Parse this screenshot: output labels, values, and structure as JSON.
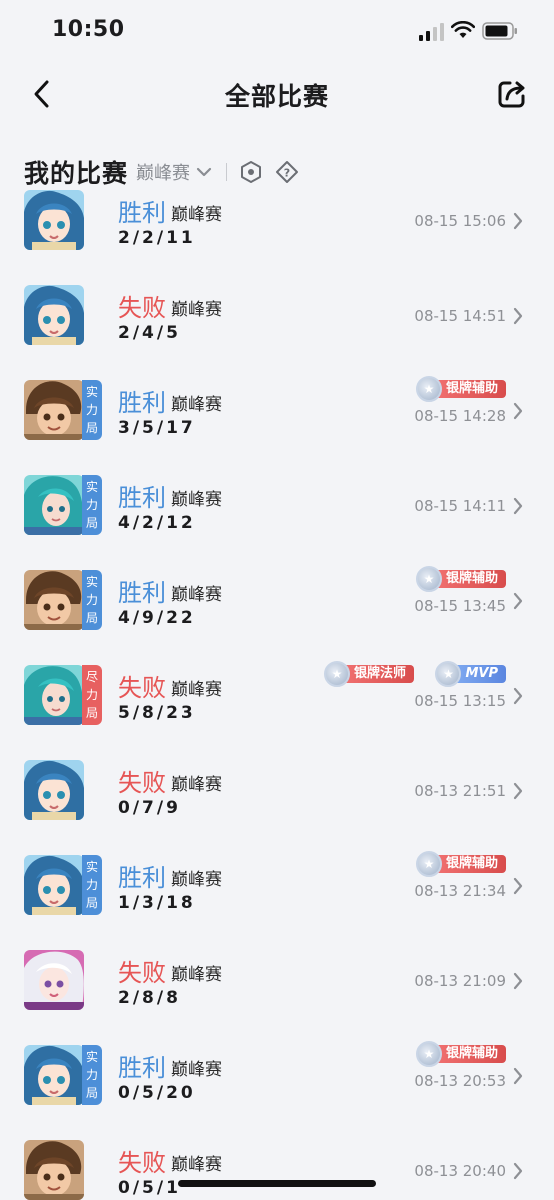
{
  "status_bar": {
    "time": "10:50"
  },
  "nav": {
    "title": "全部比赛"
  },
  "section": {
    "title": "我的比赛",
    "mode_filter": "巅峰赛"
  },
  "matches": [
    {
      "result": "胜利",
      "outcome": "win",
      "mode": "巅峰赛",
      "kda": "2/2/11",
      "time": "08-15 15:06",
      "hero": "blue-hair-girl",
      "tag": null,
      "badges": []
    },
    {
      "result": "失败",
      "outcome": "lose",
      "mode": "巅峰赛",
      "kda": "2/4/5",
      "time": "08-15 14:51",
      "hero": "blue-hair-girl",
      "tag": null,
      "badges": []
    },
    {
      "result": "胜利",
      "outcome": "win",
      "mode": "巅峰赛",
      "kda": "3/5/17",
      "time": "08-15 14:28",
      "hero": "brown-hair-boy",
      "tag": "实力局",
      "tag_color": "blue",
      "badges": [
        "银牌辅助"
      ]
    },
    {
      "result": "胜利",
      "outcome": "win",
      "mode": "巅峰赛",
      "kda": "4/2/12",
      "time": "08-15 14:11",
      "hero": "teal-hair-woman",
      "tag": "实力局",
      "tag_color": "blue",
      "badges": []
    },
    {
      "result": "胜利",
      "outcome": "win",
      "mode": "巅峰赛",
      "kda": "4/9/22",
      "time": "08-15 13:45",
      "hero": "brown-hair-boy",
      "tag": "实力局",
      "tag_color": "blue",
      "badges": [
        "银牌辅助"
      ]
    },
    {
      "result": "失败",
      "outcome": "lose",
      "mode": "巅峰赛",
      "kda": "5/8/23",
      "time": "08-15 13:15",
      "hero": "teal-hair-woman",
      "tag": "尽力局",
      "tag_color": "red",
      "badges": [
        "银牌法师",
        "MVP"
      ]
    },
    {
      "result": "失败",
      "outcome": "lose",
      "mode": "巅峰赛",
      "kda": "0/7/9",
      "time": "08-13 21:51",
      "hero": "blue-hair-girl",
      "tag": null,
      "badges": []
    },
    {
      "result": "胜利",
      "outcome": "win",
      "mode": "巅峰赛",
      "kda": "1/3/18",
      "time": "08-13 21:34",
      "hero": "blue-hair-girl",
      "tag": "实力局",
      "tag_color": "blue",
      "badges": [
        "银牌辅助"
      ]
    },
    {
      "result": "失败",
      "outcome": "lose",
      "mode": "巅峰赛",
      "kda": "2/8/8",
      "time": "08-13 21:09",
      "hero": "white-hair-girl",
      "tag": null,
      "badges": []
    },
    {
      "result": "胜利",
      "outcome": "win",
      "mode": "巅峰赛",
      "kda": "0/5/20",
      "time": "08-13 20:53",
      "hero": "blue-hair-girl",
      "tag": "实力局",
      "tag_color": "blue",
      "badges": [
        "银牌辅助"
      ]
    },
    {
      "result": "失败",
      "outcome": "lose",
      "mode": "巅峰赛",
      "kda": "0/5/1",
      "time": "08-13 20:40",
      "hero": "brown-hair-boy",
      "tag": null,
      "badges": []
    }
  ],
  "colors": {
    "win": "#4a8fd8",
    "lose": "#e65555",
    "background": "#f3f4f7"
  }
}
